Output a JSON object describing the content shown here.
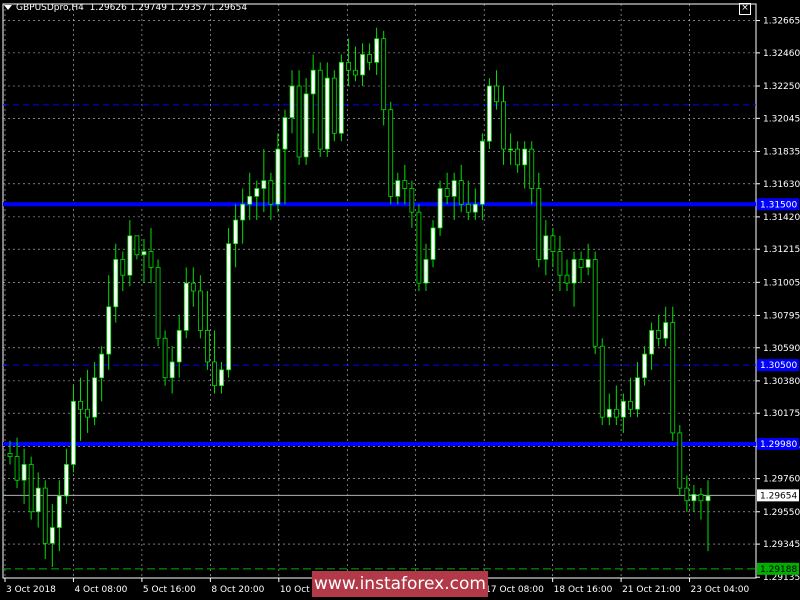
{
  "header": {
    "symbol_timeframe": "GBPUSDpro,H4",
    "ohlc": "1.29626 1.29749 1.29357 1.29654"
  },
  "watermark": "www.instaforex.com",
  "colors": {
    "background": "#000000",
    "axis": "#ffffff",
    "grid": "#c8c8c8",
    "bull_candle_body": "#ffffff",
    "bear_candle_body": "#000000",
    "wick": "#00e000",
    "level_line": "#0000ff",
    "price_line": "#b0b0b0",
    "low_line": "#00b000",
    "watermark_bg": "#b23a48"
  },
  "chart_data": {
    "type": "candlestick",
    "price_axis": {
      "min": 1.2913,
      "max": 1.3277,
      "ticks": [
        "1.32665",
        "1.32460",
        "1.32250",
        "1.32045",
        "1.31835",
        "1.31630",
        "1.31420",
        "1.31215",
        "1.31005",
        "1.30795",
        "1.30590",
        "1.30380",
        "1.30175",
        "1.29965",
        "1.29760",
        "1.29550",
        "1.29345",
        "1.29135"
      ]
    },
    "time_axis_labels": [
      "3 Oct 2018",
      "4 Oct 08:00",
      "5 Oct 16:00",
      "8 Oct 20:00",
      "10 Oct 04:00",
      "",
      "",
      "17 Oct 08:00",
      "18 Oct 16:00",
      "21 Oct 21:00",
      "23 Oct 04:00"
    ],
    "horizontal_levels": [
      {
        "price": 1.315,
        "label": "1.31500",
        "style": "solid"
      },
      {
        "price": 1.3213,
        "label": "",
        "style": "dashed"
      },
      {
        "price": 1.3048,
        "label": "1.30500",
        "style": "dashed"
      },
      {
        "price": 1.2998,
        "label": "1.29980",
        "style": "solid"
      }
    ],
    "current_price": {
      "price": 1.29654,
      "label": "1.29654"
    },
    "low_marker": {
      "price": 1.29188,
      "label": "1.29188"
    },
    "candles": [
      [
        1.2992,
        1.3,
        1.2985,
        1.299
      ],
      [
        1.299,
        1.3002,
        1.297,
        1.2975
      ],
      [
        1.2975,
        1.2995,
        1.296,
        1.2985
      ],
      [
        1.2985,
        1.299,
        1.295,
        1.2955
      ],
      [
        1.2955,
        1.298,
        1.2945,
        1.297
      ],
      [
        1.297,
        1.2975,
        1.2925,
        1.2935
      ],
      [
        1.2935,
        1.296,
        1.292,
        1.2945
      ],
      [
        1.2945,
        1.2975,
        1.293,
        1.2965
      ],
      [
        1.2965,
        1.2995,
        1.296,
        1.2985
      ],
      [
        1.2985,
        1.3035,
        1.298,
        1.3025
      ],
      [
        1.3025,
        1.304,
        1.3,
        1.302
      ],
      [
        1.302,
        1.3045,
        1.3005,
        1.3015
      ],
      [
        1.3015,
        1.305,
        1.301,
        1.304
      ],
      [
        1.304,
        1.306,
        1.3025,
        1.3055
      ],
      [
        1.3055,
        1.3105,
        1.3045,
        1.3085
      ],
      [
        1.3085,
        1.3125,
        1.3075,
        1.3115
      ],
      [
        1.3115,
        1.312,
        1.3095,
        1.3105
      ],
      [
        1.3105,
        1.314,
        1.3098,
        1.313
      ],
      [
        1.313,
        1.313,
        1.3115,
        1.3118
      ],
      [
        1.3118,
        1.3128,
        1.31,
        1.312
      ],
      [
        1.312,
        1.3135,
        1.31,
        1.311
      ],
      [
        1.311,
        1.3115,
        1.306,
        1.3065
      ],
      [
        1.3065,
        1.307,
        1.3035,
        1.304
      ],
      [
        1.304,
        1.306,
        1.303,
        1.305
      ],
      [
        1.305,
        1.308,
        1.304,
        1.307
      ],
      [
        1.307,
        1.311,
        1.3065,
        1.31
      ],
      [
        1.31,
        1.311,
        1.3085,
        1.3095
      ],
      [
        1.3095,
        1.3105,
        1.3065,
        1.307
      ],
      [
        1.307,
        1.3095,
        1.3045,
        1.305
      ],
      [
        1.305,
        1.307,
        1.303,
        1.3035
      ],
      [
        1.3035,
        1.305,
        1.303,
        1.3045
      ],
      [
        1.3045,
        1.3135,
        1.304,
        1.3125
      ],
      [
        1.3125,
        1.315,
        1.311,
        1.314
      ],
      [
        1.314,
        1.316,
        1.3125,
        1.315
      ],
      [
        1.315,
        1.317,
        1.314,
        1.3155
      ],
      [
        1.3155,
        1.3165,
        1.314,
        1.316
      ],
      [
        1.316,
        1.3185,
        1.3145,
        1.3165
      ],
      [
        1.3165,
        1.317,
        1.314,
        1.315
      ],
      [
        1.315,
        1.3195,
        1.3145,
        1.3185
      ],
      [
        1.3185,
        1.321,
        1.315,
        1.3205
      ],
      [
        1.3205,
        1.3235,
        1.3195,
        1.3225
      ],
      [
        1.3225,
        1.3235,
        1.3175,
        1.318
      ],
      [
        1.318,
        1.323,
        1.3175,
        1.322
      ],
      [
        1.322,
        1.3245,
        1.3195,
        1.3235
      ],
      [
        1.3235,
        1.324,
        1.318,
        1.3185
      ],
      [
        1.3185,
        1.324,
        1.318,
        1.323
      ],
      [
        1.323,
        1.3235,
        1.319,
        1.3195
      ],
      [
        1.3195,
        1.3245,
        1.319,
        1.324
      ],
      [
        1.324,
        1.3255,
        1.3225,
        1.3235
      ],
      [
        1.3235,
        1.325,
        1.3228,
        1.3232
      ],
      [
        1.3232,
        1.3252,
        1.3225,
        1.3245
      ],
      [
        1.3245,
        1.3252,
        1.3235,
        1.324
      ],
      [
        1.324,
        1.3262,
        1.3232,
        1.3255
      ],
      [
        1.3255,
        1.326,
        1.32,
        1.321
      ],
      [
        1.321,
        1.3215,
        1.315,
        1.3155
      ],
      [
        1.3155,
        1.317,
        1.315,
        1.3165
      ],
      [
        1.3165,
        1.3175,
        1.315,
        1.316
      ],
      [
        1.316,
        1.3165,
        1.3135,
        1.3145
      ],
      [
        1.3145,
        1.315,
        1.3095,
        1.31
      ],
      [
        1.31,
        1.3125,
        1.3095,
        1.3115
      ],
      [
        1.3115,
        1.314,
        1.311,
        1.3135
      ],
      [
        1.3135,
        1.3165,
        1.313,
        1.316
      ],
      [
        1.316,
        1.317,
        1.315,
        1.3155
      ],
      [
        1.3155,
        1.317,
        1.314,
        1.3165
      ],
      [
        1.3165,
        1.3175,
        1.3145,
        1.315
      ],
      [
        1.315,
        1.3165,
        1.314,
        1.3145
      ],
      [
        1.3145,
        1.316,
        1.314,
        1.315
      ],
      [
        1.315,
        1.3195,
        1.314,
        1.319
      ],
      [
        1.319,
        1.323,
        1.3185,
        1.3225
      ],
      [
        1.3225,
        1.3235,
        1.321,
        1.3215
      ],
      [
        1.3215,
        1.3225,
        1.3175,
        1.3185
      ],
      [
        1.3185,
        1.3195,
        1.3175,
        1.3185
      ],
      [
        1.3185,
        1.319,
        1.317,
        1.3175
      ],
      [
        1.3175,
        1.319,
        1.316,
        1.3185
      ],
      [
        1.3185,
        1.319,
        1.315,
        1.316
      ],
      [
        1.316,
        1.317,
        1.311,
        1.3115
      ],
      [
        1.3115,
        1.314,
        1.3105,
        1.313
      ],
      [
        1.313,
        1.3135,
        1.311,
        1.312
      ],
      [
        1.312,
        1.313,
        1.3095,
        1.3105
      ],
      [
        1.3105,
        1.3115,
        1.3095,
        1.31
      ],
      [
        1.31,
        1.312,
        1.3085,
        1.3115
      ],
      [
        1.3115,
        1.312,
        1.31,
        1.311
      ],
      [
        1.311,
        1.3125,
        1.3105,
        1.3115
      ],
      [
        1.3115,
        1.312,
        1.3055,
        1.306
      ],
      [
        1.306,
        1.3065,
        1.301,
        1.3015
      ],
      [
        1.3015,
        1.303,
        1.301,
        1.302
      ],
      [
        1.302,
        1.3035,
        1.301,
        1.3015
      ],
      [
        1.3015,
        1.303,
        1.3005,
        1.3025
      ],
      [
        1.3025,
        1.304,
        1.3015,
        1.302
      ],
      [
        1.302,
        1.305,
        1.3015,
        1.304
      ],
      [
        1.304,
        1.306,
        1.3035,
        1.3055
      ],
      [
        1.3055,
        1.3075,
        1.3045,
        1.307
      ],
      [
        1.307,
        1.308,
        1.306,
        1.3065
      ],
      [
        1.3065,
        1.3085,
        1.306,
        1.3075
      ],
      [
        1.3075,
        1.3085,
        1.3,
        1.3005
      ],
      [
        1.3005,
        1.301,
        1.2965,
        1.297
      ],
      [
        1.297,
        1.2978,
        1.2955,
        1.2962
      ],
      [
        1.2962,
        1.2972,
        1.2955,
        1.2966
      ],
      [
        1.2966,
        1.297,
        1.295,
        1.2962
      ],
      [
        1.2962,
        1.2975,
        1.293,
        1.2965
      ]
    ]
  }
}
